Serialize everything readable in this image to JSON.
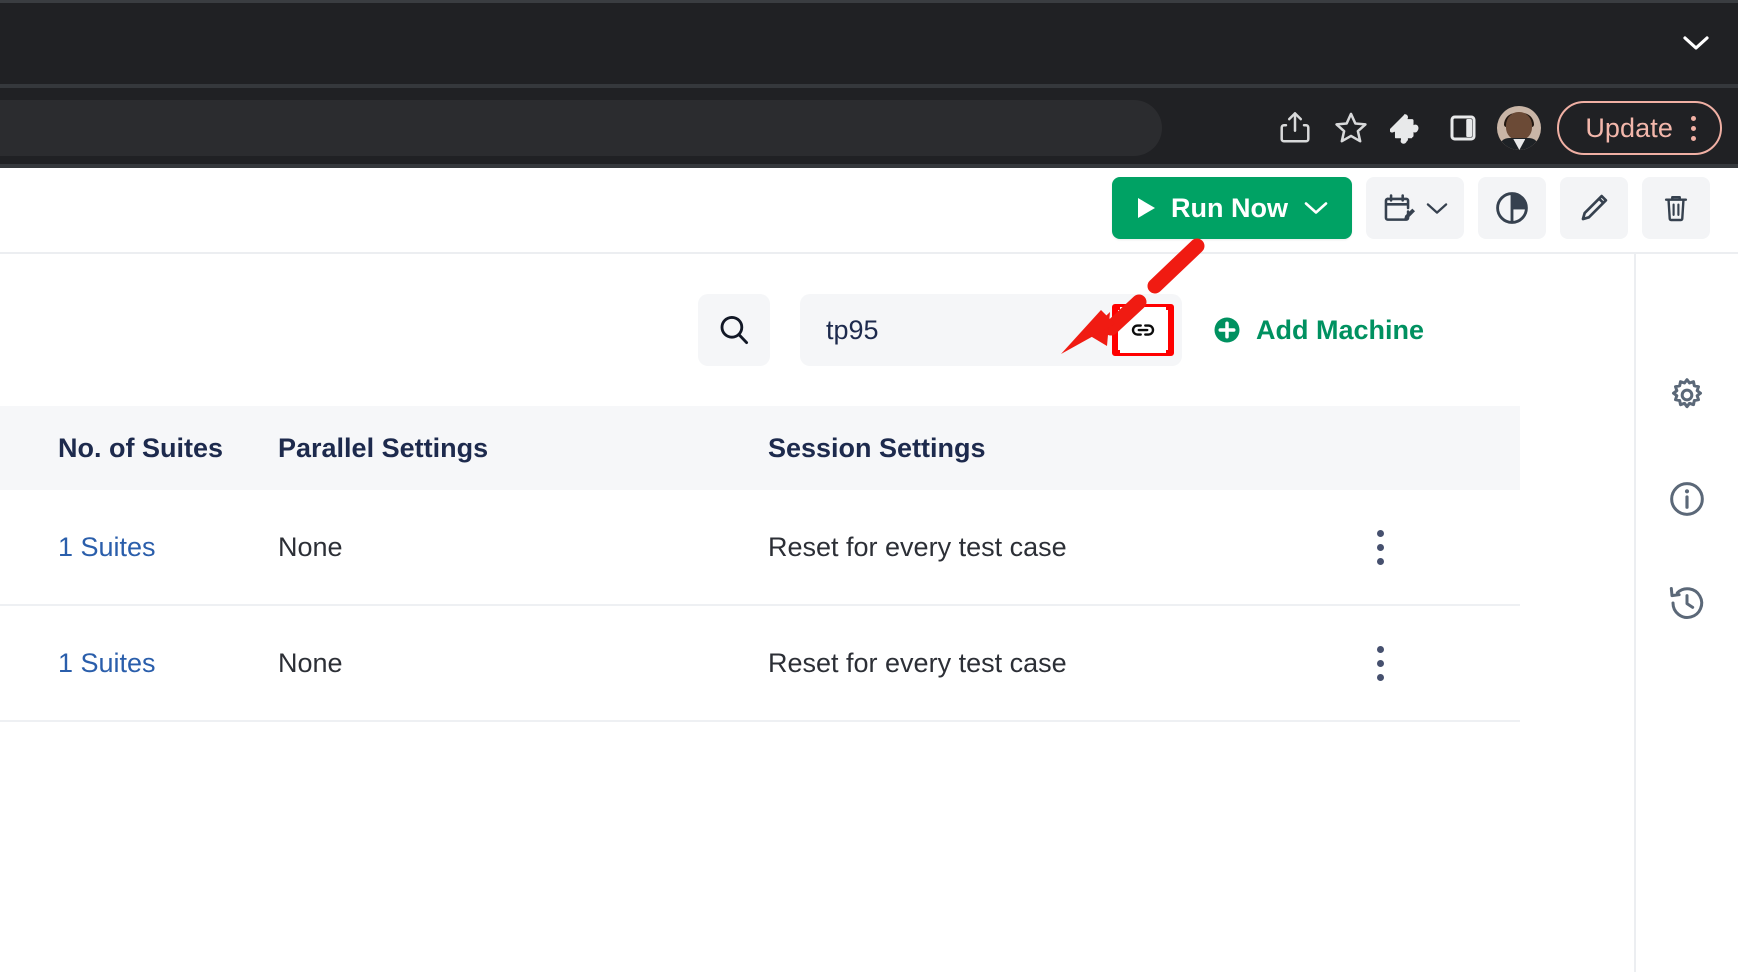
{
  "browser": {
    "tabstrip": {
      "chevron_icon": "chevron-down-icon"
    },
    "toolbar": {
      "share_icon": "share-icon",
      "bookmark_icon": "star-icon",
      "extensions_icon": "puzzle-piece-icon",
      "sidepanel_icon": "side-panel-icon",
      "avatar_icon": "profile-avatar",
      "update_label": "Update",
      "menu_icon": "vertical-kebab-icon"
    }
  },
  "app": {
    "toolbar": {
      "run_now_label": "Run Now",
      "run_now_play_icon": "play-icon",
      "run_now_caret_icon": "chevron-down-icon",
      "schedule_icon": "calendar-edit-icon",
      "schedule_caret_icon": "chevron-down-icon",
      "analytics_icon": "pie-chart-icon",
      "edit_icon": "pencil-icon",
      "delete_icon": "trash-icon"
    },
    "filters": {
      "search_icon": "search-icon",
      "search_value": "tp95",
      "search_placeholder": "Search",
      "link_icon": "chain-link-icon",
      "add_machine_label": "Add Machine",
      "add_machine_icon": "plus-circle-icon"
    },
    "table": {
      "headers": [
        "No. of Suites",
        "Parallel Settings",
        "Session Settings",
        ""
      ],
      "rows": [
        {
          "suites": "1 Suites",
          "parallel": "None",
          "session": "Reset for every test case",
          "menu_icon": "vertical-kebab-icon"
        },
        {
          "suites": "1 Suites",
          "parallel": "None",
          "session": "Reset for every test case",
          "menu_icon": "vertical-kebab-icon"
        }
      ]
    },
    "rail": {
      "items": [
        {
          "icon": "gear-icon",
          "name": "settings"
        },
        {
          "icon": "info-circle-icon",
          "name": "info"
        },
        {
          "icon": "history-clock-icon",
          "name": "history"
        }
      ]
    }
  },
  "annotation": {
    "arrow_icon": "dashed-arrow-annotation",
    "arrow_color": "#f01b12",
    "highlight_color": "#ff0000"
  },
  "colors": {
    "accent_green": "#00a264",
    "link_blue": "#2a5eab",
    "heading_navy": "#1d2a4d",
    "chrome_dark": "#202124",
    "update_pink": "#f0b0a4"
  }
}
